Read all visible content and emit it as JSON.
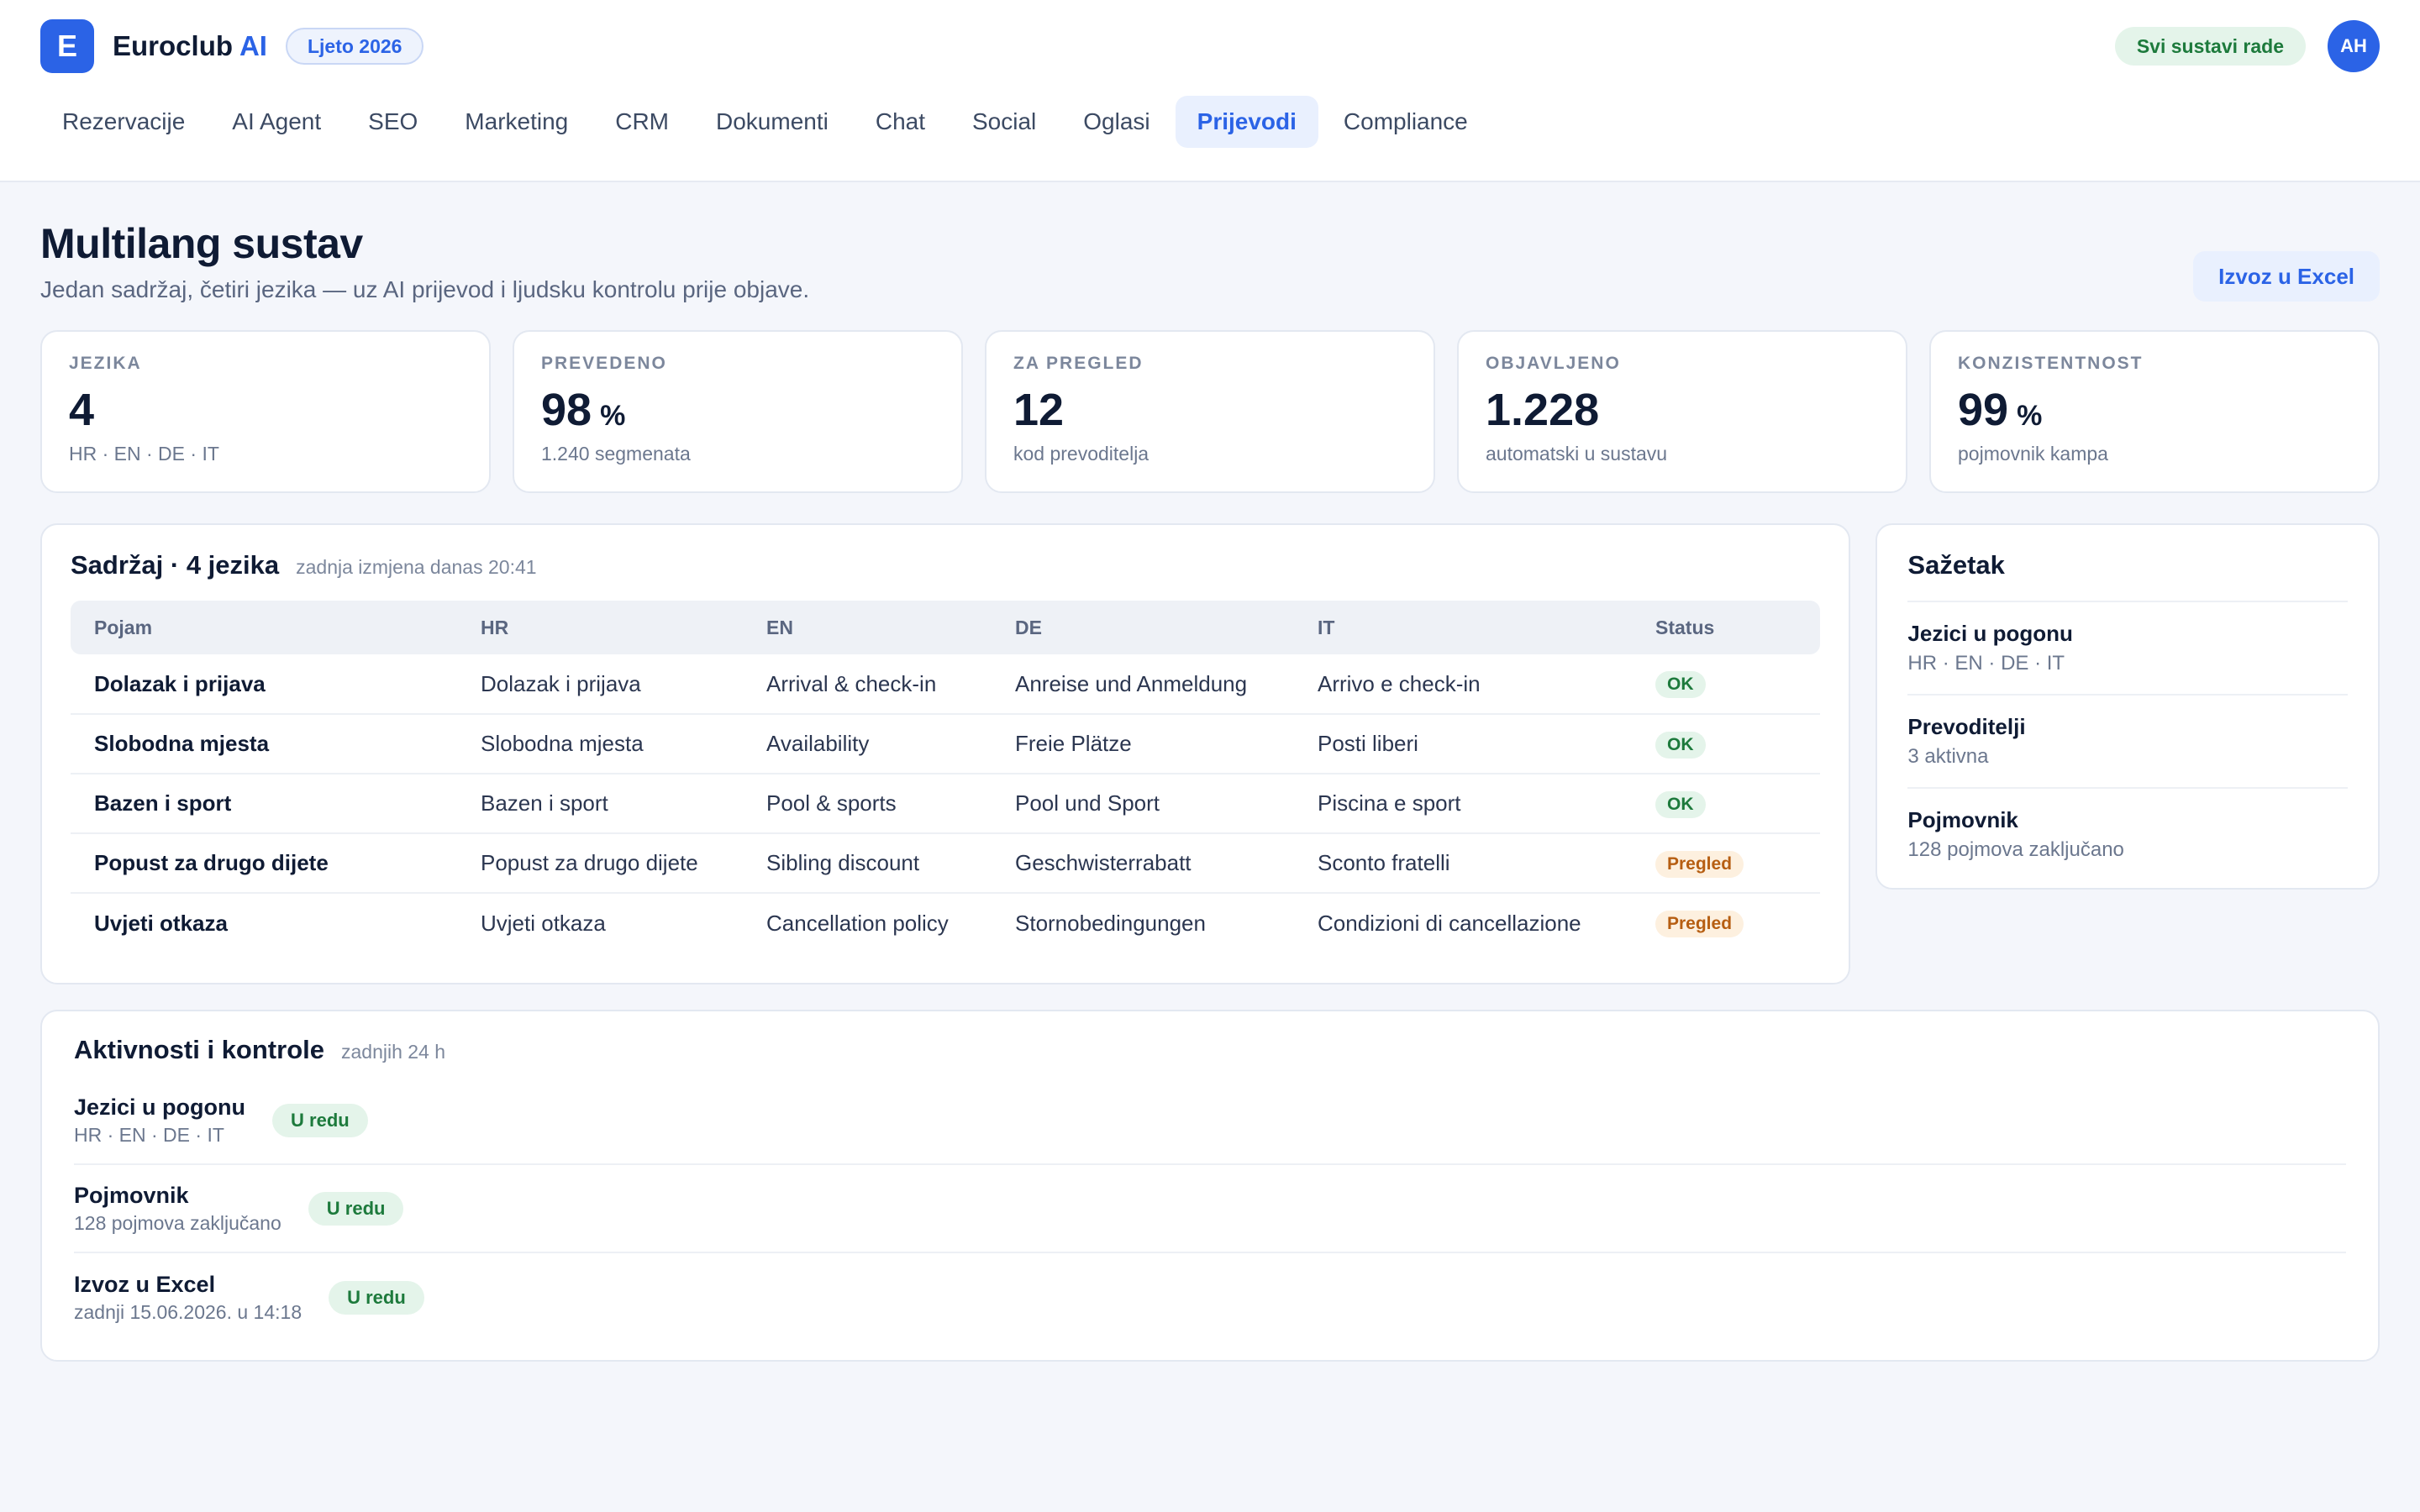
{
  "header": {
    "logo_letter": "E",
    "brand_main": "Euroclub",
    "brand_ai": "AI",
    "season": "Ljeto 2026",
    "system_status": "Svi sustavi rade",
    "avatar_initials": "AH"
  },
  "nav": {
    "items": [
      "Rezervacije",
      "AI Agent",
      "SEO",
      "Marketing",
      "CRM",
      "Dokumenti",
      "Chat",
      "Social",
      "Oglasi",
      "Prijevodi",
      "Compliance"
    ],
    "active": "Prijevodi"
  },
  "page": {
    "title": "Multilang sustav",
    "subtitle": "Jedan sadržaj, četiri jezika — uz AI prijevod i ljudsku kontrolu prije objave.",
    "export_label": "Izvoz u Excel"
  },
  "stats": [
    {
      "label": "JEZIKA",
      "value": "4",
      "unit": "",
      "sub": "HR · EN · DE · IT"
    },
    {
      "label": "PREVEDENO",
      "value": "98",
      "unit": "%",
      "sub": "1.240 segmenata"
    },
    {
      "label": "ZA PREGLED",
      "value": "12",
      "unit": "",
      "sub": "kod prevoditelja"
    },
    {
      "label": "OBJAVLJENO",
      "value": "1.228",
      "unit": "",
      "sub": "automatski u sustavu"
    },
    {
      "label": "KONZISTENTNOST",
      "value": "99",
      "unit": "%",
      "sub": "pojmovnik kampa"
    }
  ],
  "content": {
    "title": "Sadržaj · 4 jezika",
    "meta": "zadnja izmjena danas 20:41",
    "columns": [
      "Pojam",
      "HR",
      "EN",
      "DE",
      "IT",
      "Status"
    ],
    "rows": [
      {
        "term": "Dolazak i prijava",
        "hr": "Dolazak i prijava",
        "en": "Arrival & check-in",
        "de": "Anreise und Anmeldung",
        "it": "Arrivo e check-in",
        "status": "OK"
      },
      {
        "term": "Slobodna mjesta",
        "hr": "Slobodna mjesta",
        "en": "Availability",
        "de": "Freie Plätze",
        "it": "Posti liberi",
        "status": "OK"
      },
      {
        "term": "Bazen i sport",
        "hr": "Bazen i sport",
        "en": "Pool & sports",
        "de": "Pool und Sport",
        "it": "Piscina e sport",
        "status": "OK"
      },
      {
        "term": "Popust za drugo dijete",
        "hr": "Popust za drugo dijete",
        "en": "Sibling discount",
        "de": "Geschwisterrabatt",
        "it": "Sconto fratelli",
        "status": "Pregled"
      },
      {
        "term": "Uvjeti otkaza",
        "hr": "Uvjeti otkaza",
        "en": "Cancellation policy",
        "de": "Stornobedingungen",
        "it": "Condizioni di cancellazione",
        "status": "Pregled"
      }
    ]
  },
  "summary": {
    "title": "Sažetak",
    "items": [
      {
        "name": "Jezici u pogonu",
        "value": "HR · EN · DE · IT"
      },
      {
        "name": "Prevoditelji",
        "value": "3 aktivna"
      },
      {
        "name": "Pojmovnik",
        "value": "128 pojmova zaključano"
      }
    ]
  },
  "activity": {
    "title": "Aktivnosti i kontrole",
    "meta": "zadnjih 24 h",
    "items": [
      {
        "name": "Jezici u pogonu",
        "sub": "HR · EN · DE · IT",
        "badge": "U redu"
      },
      {
        "name": "Pojmovnik",
        "sub": "128 pojmova zaključano",
        "badge": "U redu"
      },
      {
        "name": "Izvoz u Excel",
        "sub": "zadnji 15.06.2026. u 14:18",
        "badge": "U redu"
      }
    ]
  },
  "colors": {
    "accent": "#2b63e6",
    "ok_bg": "#e4f4ea",
    "ok_fg": "#1d7a3c",
    "review_bg": "#fdf0df",
    "review_fg": "#b65e12"
  }
}
